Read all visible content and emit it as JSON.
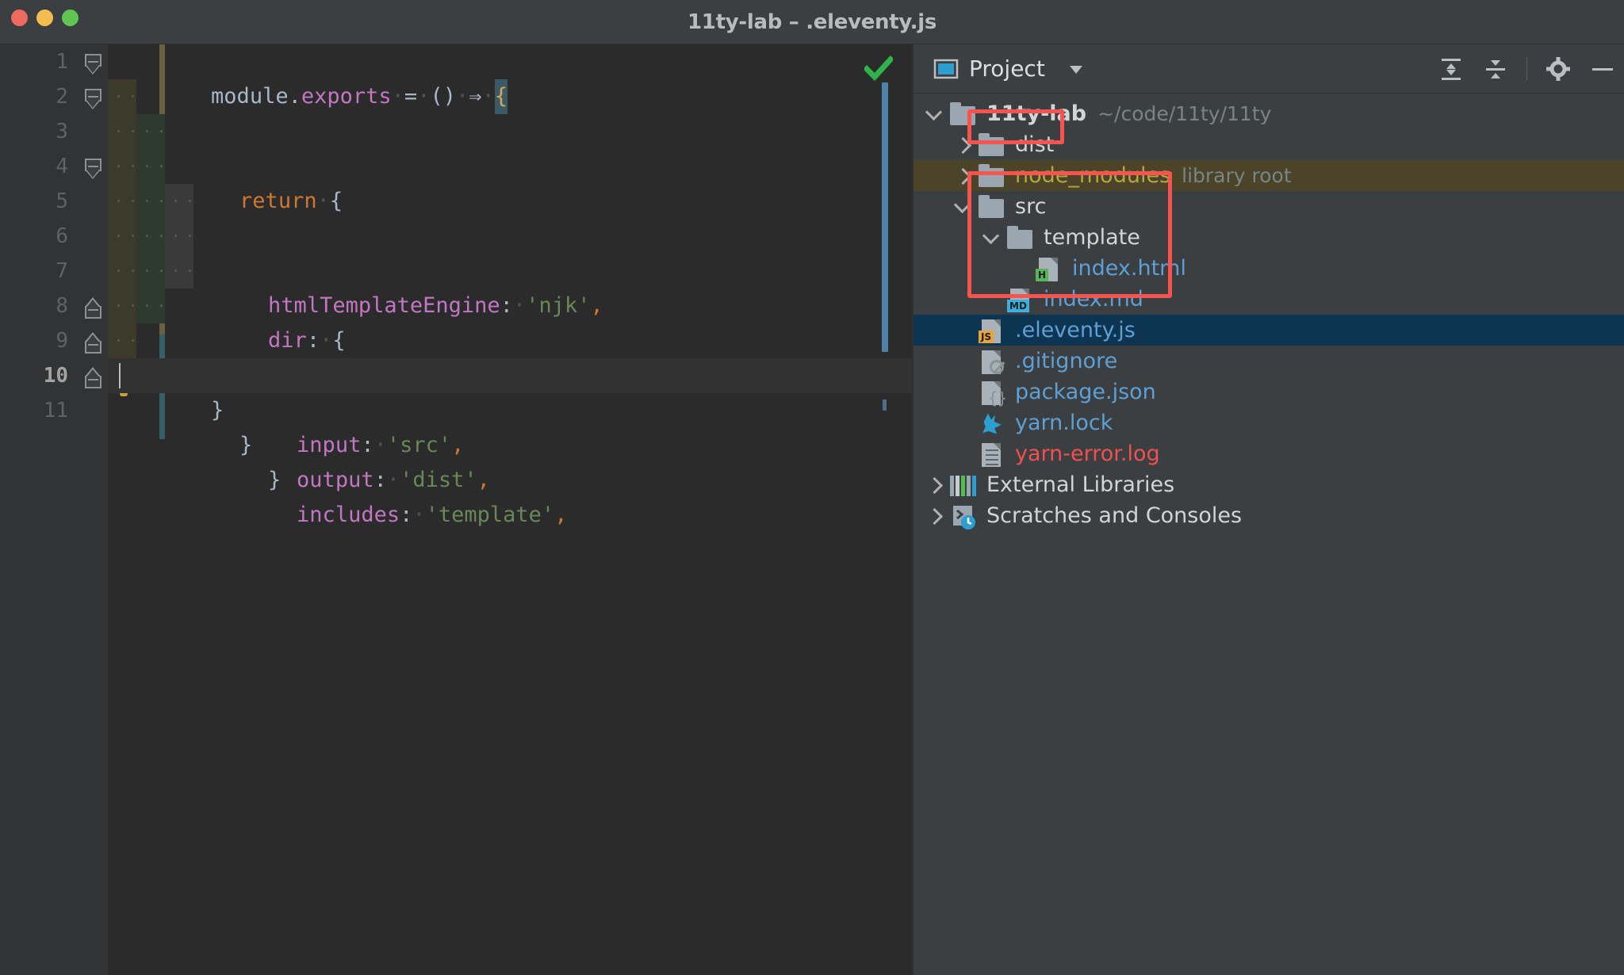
{
  "window": {
    "title": "11ty-lab – .eleventy.js",
    "traffic_lights": [
      "close-red",
      "minimize-yellow",
      "maximize-green"
    ]
  },
  "editor": {
    "filename": ".eleventy.js",
    "status_icon": "green-check",
    "line_numbers": [
      "1",
      "2",
      "3",
      "4",
      "5",
      "6",
      "7",
      "8",
      "9",
      "10",
      "11"
    ],
    "current_line": 10,
    "lines": [
      {
        "n": 1,
        "text": "module.exports = () => {"
      },
      {
        "n": 2,
        "text": "  return {"
      },
      {
        "n": 3,
        "text": "    htmlTemplateEngine: 'njk',"
      },
      {
        "n": 4,
        "text": "    dir: {"
      },
      {
        "n": 5,
        "text": "      input: 'src',"
      },
      {
        "n": 6,
        "text": "      output: 'dist',"
      },
      {
        "n": 7,
        "text": "      includes: 'template',"
      },
      {
        "n": 8,
        "text": "    }"
      },
      {
        "n": 9,
        "text": "  }"
      },
      {
        "n": 10,
        "text": "}"
      },
      {
        "n": 11,
        "text": ""
      }
    ],
    "tokens": {
      "module": "module",
      "exports": "exports",
      "dot": ".",
      "equals": "=",
      "parens": "()",
      "arrow": "⇒",
      "open_brace": "{",
      "close_brace": "}",
      "return": "return",
      "htmlTemplateEngine": "htmlTemplateEngine",
      "colon": ":",
      "njk": "'njk'",
      "comma": ",",
      "dir": "dir",
      "input": "input",
      "src_str": "'src'",
      "output": "output",
      "dist_str": "'dist'",
      "includes": "includes",
      "template_str": "'template'"
    },
    "colors": {
      "background": "#2b2b2b",
      "gutter": "#313335",
      "keyword": "#cc7832",
      "property": "#c177c1",
      "string": "#6a8759",
      "default_text": "#a9b7c6",
      "line_number": "#606366",
      "caret_block": "#3c5a66"
    },
    "intention_bulb": "lightbulb-icon"
  },
  "project_panel": {
    "header": {
      "title": "Project",
      "window_icon": "project-window-icon",
      "dropdown_icon": "chevron-down-icon",
      "expand_all_icon": "expand-all-icon",
      "collapse_all_icon": "collapse-all-icon",
      "settings_icon": "gear-icon",
      "hide_icon": "minimize-icon"
    },
    "tree": [
      {
        "id": "root",
        "label": "11ty-lab",
        "sublabel": "~/code/11ty/11ty",
        "icon": "folder",
        "chevron": "down",
        "depth": 0,
        "style": "bold"
      },
      {
        "id": "dist",
        "label": "dist",
        "sublabel": "",
        "icon": "folder",
        "chevron": "right",
        "depth": 1,
        "style": "normal"
      },
      {
        "id": "node_modules",
        "label": "node_modules",
        "sublabel": "library root",
        "icon": "folder",
        "chevron": "right",
        "depth": 1,
        "style": "libroot"
      },
      {
        "id": "src",
        "label": "src",
        "sublabel": "",
        "icon": "folder",
        "chevron": "down",
        "depth": 1,
        "style": "normal"
      },
      {
        "id": "template",
        "label": "template",
        "sublabel": "",
        "icon": "folder",
        "chevron": "down",
        "depth": 2,
        "style": "normal"
      },
      {
        "id": "index_html",
        "label": "index.html",
        "sublabel": "",
        "icon": "file-html",
        "chevron": "none",
        "depth": 3,
        "style": "file"
      },
      {
        "id": "index_md",
        "label": "index.md",
        "sublabel": "",
        "icon": "file-md",
        "chevron": "none",
        "depth": 2,
        "style": "file"
      },
      {
        "id": "eleventy",
        "label": ".eleventy.js",
        "sublabel": "",
        "icon": "file-js",
        "chevron": "none",
        "depth": 1,
        "style": "file-selected"
      },
      {
        "id": "gitignore",
        "label": ".gitignore",
        "sublabel": "",
        "icon": "file-git",
        "chevron": "none",
        "depth": 1,
        "style": "file"
      },
      {
        "id": "packagejson",
        "label": "package.json",
        "sublabel": "",
        "icon": "file-json",
        "chevron": "none",
        "depth": 1,
        "style": "file"
      },
      {
        "id": "yarnlock",
        "label": "yarn.lock",
        "sublabel": "",
        "icon": "file-yarn",
        "chevron": "none",
        "depth": 1,
        "style": "file"
      },
      {
        "id": "yarnerror",
        "label": "yarn-error.log",
        "sublabel": "",
        "icon": "file-log",
        "chevron": "none",
        "depth": 1,
        "style": "file-red"
      },
      {
        "id": "extlibs",
        "label": "External Libraries",
        "sublabel": "",
        "icon": "libraries",
        "chevron": "right",
        "depth": 0,
        "style": "normal"
      },
      {
        "id": "scratches",
        "label": "Scratches and Consoles",
        "sublabel": "",
        "icon": "scratches",
        "chevron": "right",
        "depth": 0,
        "style": "normal"
      }
    ],
    "selected_item": ".eleventy.js"
  },
  "annotations": {
    "color": "#f7544f",
    "boxes": [
      {
        "name": "highlight-dist",
        "target": "dist"
      },
      {
        "name": "highlight-src-tree",
        "target": "src / template / index.html / index.md"
      }
    ]
  }
}
